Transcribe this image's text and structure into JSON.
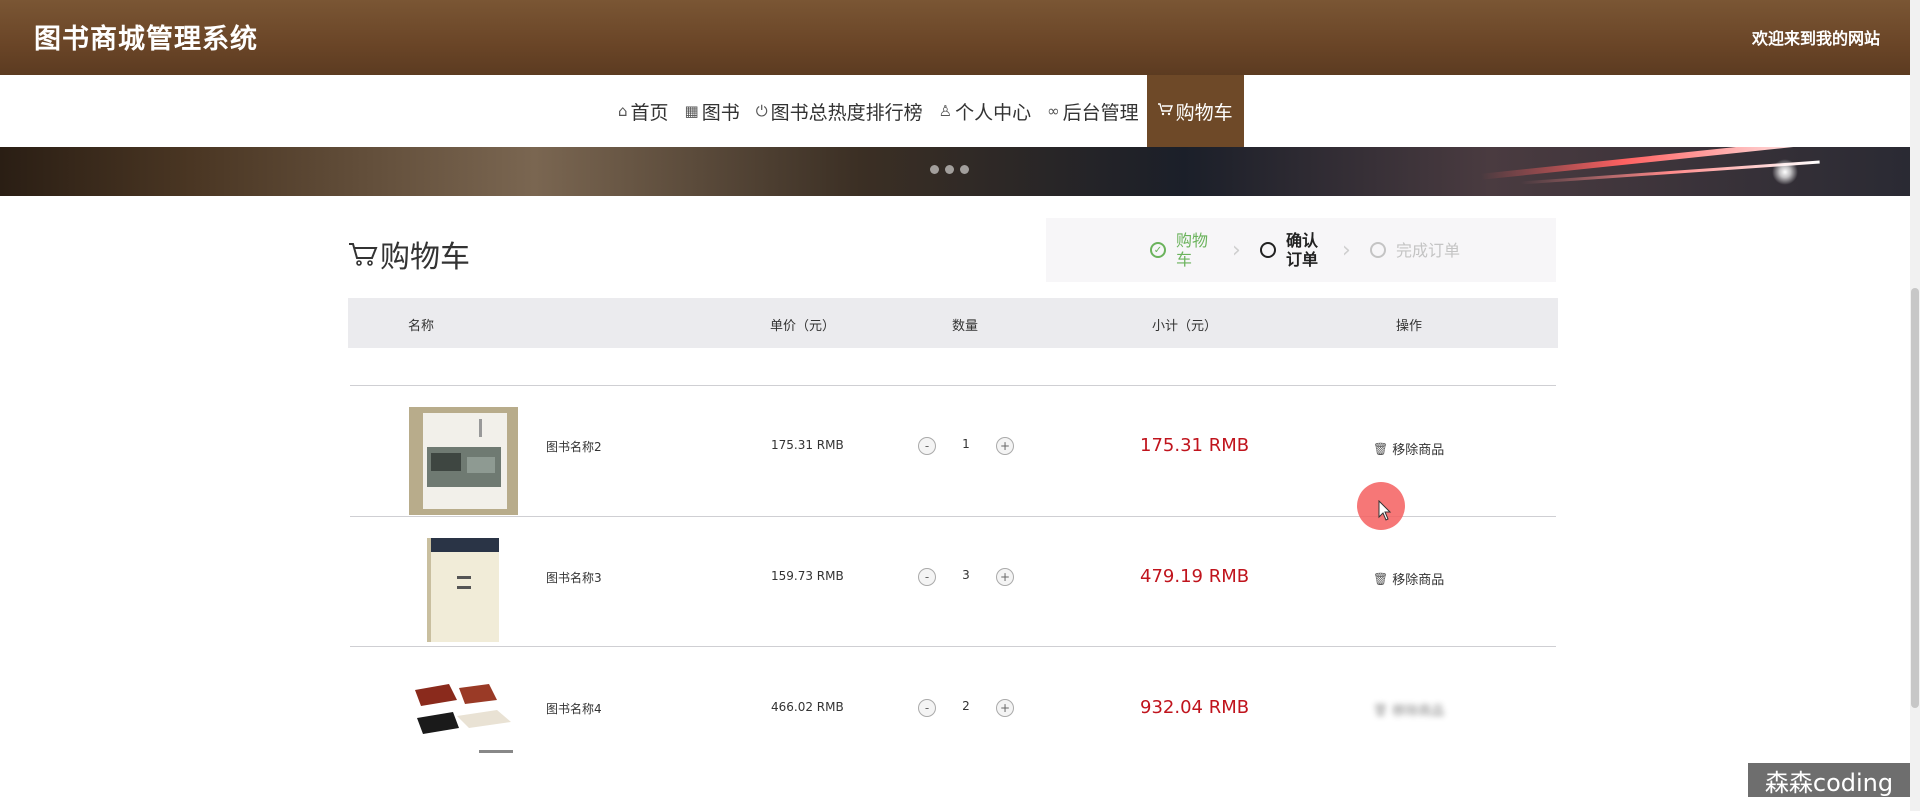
{
  "header": {
    "site_title": "图书商城管理系统",
    "welcome": "欢迎来到我的网站"
  },
  "nav": {
    "items": [
      {
        "label": "首页",
        "icon": "home-icon"
      },
      {
        "label": "图书",
        "icon": "grid-icon"
      },
      {
        "label": "图书总热度排行榜",
        "icon": "power-icon"
      },
      {
        "label": "个人中心",
        "icon": "user-icon"
      },
      {
        "label": "后台管理",
        "icon": "link-icon"
      },
      {
        "label": "购物车",
        "icon": "cart-icon",
        "active": true
      }
    ]
  },
  "cart": {
    "title": "购物车",
    "steps": [
      {
        "label": "购物车",
        "state": "done"
      },
      {
        "label": "确认订单",
        "state": "current"
      },
      {
        "label": "完成订单",
        "state": "pending"
      }
    ],
    "columns": {
      "name": "名称",
      "price": "单价（元）",
      "qty": "数量",
      "subtotal": "小计（元）",
      "action": "操作"
    },
    "rows": [
      {
        "name": "图书名称2",
        "price": "175.31 RMB",
        "qty": "1",
        "subtotal": "175.31 RMB",
        "action": "移除商品"
      },
      {
        "name": "图书名称3",
        "price": "159.73 RMB",
        "qty": "3",
        "subtotal": "479.19 RMB",
        "action": "移除商品"
      },
      {
        "name": "图书名称4",
        "price": "466.02 RMB",
        "qty": "2",
        "subtotal": "932.04 RMB",
        "action": "移除商品"
      }
    ],
    "qty_minus": "-",
    "qty_plus": "+"
  },
  "watermark": "森森coding",
  "colors": {
    "header_bg": "#6a4527",
    "active_tab": "#6e4928",
    "price_red": "#c0141d",
    "step_done": "#6bb35c"
  }
}
